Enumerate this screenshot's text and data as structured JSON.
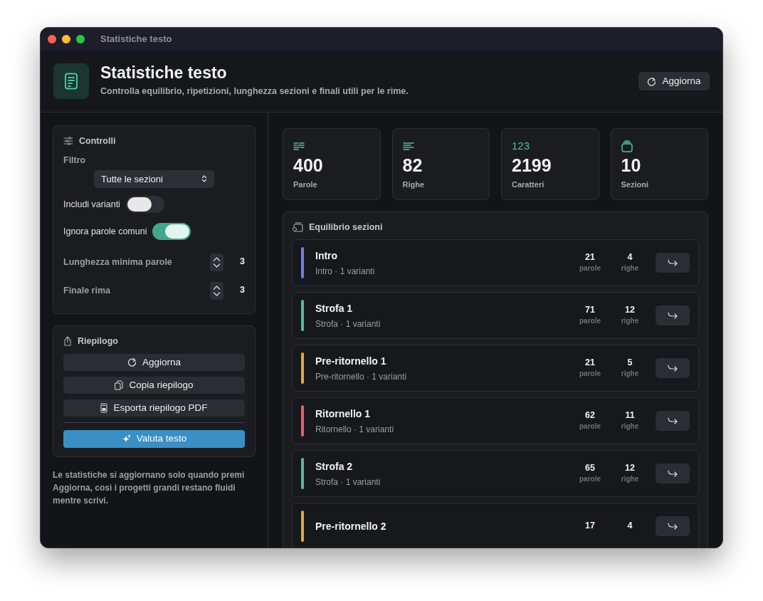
{
  "window": {
    "title": "Statistiche testo"
  },
  "header": {
    "title": "Statistiche testo",
    "subtitle": "Controlla equilibrio, ripetizioni, lunghezza sezioni e finali utili per le rime.",
    "refresh_button": "Aggiorna"
  },
  "controls": {
    "title": "Controlli",
    "filter_label": "Filtro",
    "filter_value": "Tutte le sezioni",
    "toggles": [
      {
        "label": "Includi varianti",
        "on": false
      },
      {
        "label": "Ignora parole comuni",
        "on": true
      }
    ],
    "steppers": [
      {
        "label": "Lunghezza minima parole",
        "value": "3"
      },
      {
        "label": "Finale rima",
        "value": "3"
      }
    ]
  },
  "summary": {
    "title": "Riepilogo",
    "buttons": [
      {
        "label": "Aggiorna",
        "kind": "refresh"
      },
      {
        "label": "Copia riepilogo",
        "kind": "copy"
      },
      {
        "label": "Esporta riepilogo PDF",
        "kind": "export"
      }
    ],
    "primary_button": "Valuta testo"
  },
  "note": "Le statistiche si aggiornano solo quando premi Aggiorna, così i progetti grandi restano fluidi mentre scrivi.",
  "stats": [
    {
      "value": "400",
      "label": "Parole",
      "kind": "words"
    },
    {
      "value": "82",
      "label": "Righe",
      "kind": "lines"
    },
    {
      "value": "2199",
      "label": "Caratteri",
      "kind": "chars",
      "icon_text": "123"
    },
    {
      "value": "10",
      "label": "Sezioni",
      "kind": "sections"
    }
  ],
  "balance": {
    "title": "Equilibrio sezioni",
    "sections": [
      {
        "name": "Intro",
        "detail": "Intro · 1 varianti",
        "words": "21",
        "words_label": "parole",
        "lines": "4",
        "lines_label": "righe",
        "color": "#6b7ff0"
      },
      {
        "name": "Strofa 1",
        "detail": "Strofa · 1 varianti",
        "words": "71",
        "words_label": "parole",
        "lines": "12",
        "lines_label": "righe",
        "color": "#4fbf9c"
      },
      {
        "name": "Pre-ritornello 1",
        "detail": "Pre-ritornello · 1 varianti",
        "words": "21",
        "words_label": "parole",
        "lines": "5",
        "lines_label": "righe",
        "color": "#e3a83d"
      },
      {
        "name": "Ritornello 1",
        "detail": "Ritornello · 1 varianti",
        "words": "62",
        "words_label": "parole",
        "lines": "11",
        "lines_label": "righe",
        "color": "#ee5d67"
      },
      {
        "name": "Strofa 2",
        "detail": "Strofa · 1 varianti",
        "words": "65",
        "words_label": "parole",
        "lines": "12",
        "lines_label": "righe",
        "color": "#4fbf9c"
      },
      {
        "name": "Pre-ritornello 2",
        "words": "17",
        "lines": "4",
        "color": "#e3a83d"
      }
    ]
  }
}
